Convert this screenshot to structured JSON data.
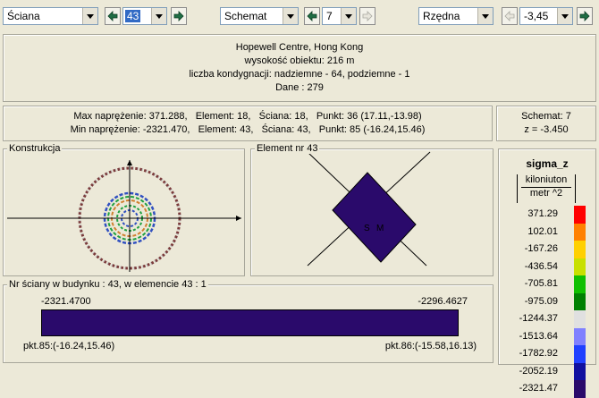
{
  "toolbar": {
    "wall_select": "Ściana",
    "wall_number": "43",
    "scheme_select": "Schemat",
    "scheme_number": "7",
    "axis_select": "Rzędna",
    "axis_value": "-3,45"
  },
  "info": {
    "building_name": "Hopewell Centre, Hong Kong",
    "height_line": "wysokość obiektu: 216 m",
    "floors_line": "liczba kondygnacji: nadziemne - 64, podziemne - 1",
    "data_line": "Dane :   279"
  },
  "stress": {
    "max_line": "Max naprężenie: 371.288,   Element: 18,   Ściana: 18,   Punkt: 36 (17.11,-13.98)",
    "min_line": "Min naprężenie: -2321.470,   Element: 43,   Ściana: 43,   Punkt: 85 (-16.24,15.46)"
  },
  "scheme_info": {
    "scheme_line": "Schemat: 7",
    "z_line": "z = -3.450"
  },
  "construction_panel": {
    "title": "Konstrukcja"
  },
  "element_panel": {
    "title": "Element nr 43",
    "label_s": "S",
    "label_m": "M"
  },
  "wall_panel": {
    "title": "Nr ściany w budynku :  43,   w elemencie 43 :  1",
    "left_value": "-2321.4700",
    "right_value": "-2296.4627",
    "left_point": "pkt.85:(-16.24,15.46)",
    "right_point": "pkt.86:(-15.58,16.13)",
    "bar_color": "#2a0a6b"
  },
  "legend": {
    "title": "sigma_z",
    "unit_top": "kiloniuton",
    "unit_bottom": "metr ^2",
    "values": [
      "371.29",
      "102.01",
      "-167.26",
      "-436.54",
      "-705.81",
      "-975.09",
      "-1244.37",
      "-1513.64",
      "-1782.92",
      "-2052.19",
      "-2321.47"
    ],
    "colors": [
      "#ff0000",
      "#ff8000",
      "#ffd000",
      "#c8e000",
      "#10c000",
      "#008000",
      "#e0e0e0",
      "#8080ff",
      "#2040ff",
      "#1010a0",
      "#2a0a6b"
    ]
  }
}
